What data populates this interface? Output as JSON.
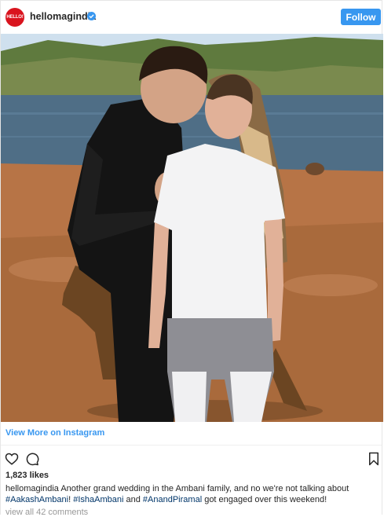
{
  "header": {
    "avatar_text": "HELLO!",
    "username": "hellomagindia",
    "follow_label": "Follow"
  },
  "photo": {
    "description_icon": "photo"
  },
  "view_more": "View More on Instagram",
  "actions": {
    "like_icon": "heart-icon",
    "comment_icon": "comment-icon",
    "save_icon": "bookmark-icon"
  },
  "likes": "1,823 likes",
  "caption": {
    "username": "hellomagindia",
    "text1": " Another grand wedding in the Ambani family, and no we're not talking about",
    "tag1": "#AakashAmbani",
    "text2": "! ",
    "tag2": "#IshaAmbani",
    "text3": " and ",
    "tag3": "#AnandPiramal",
    "text4": " got engaged over this weekend!"
  },
  "comments_link": "view all 42 comments",
  "colors": {
    "accent": "#3897f0",
    "brand": "#d9141e",
    "tag": "#003569"
  }
}
